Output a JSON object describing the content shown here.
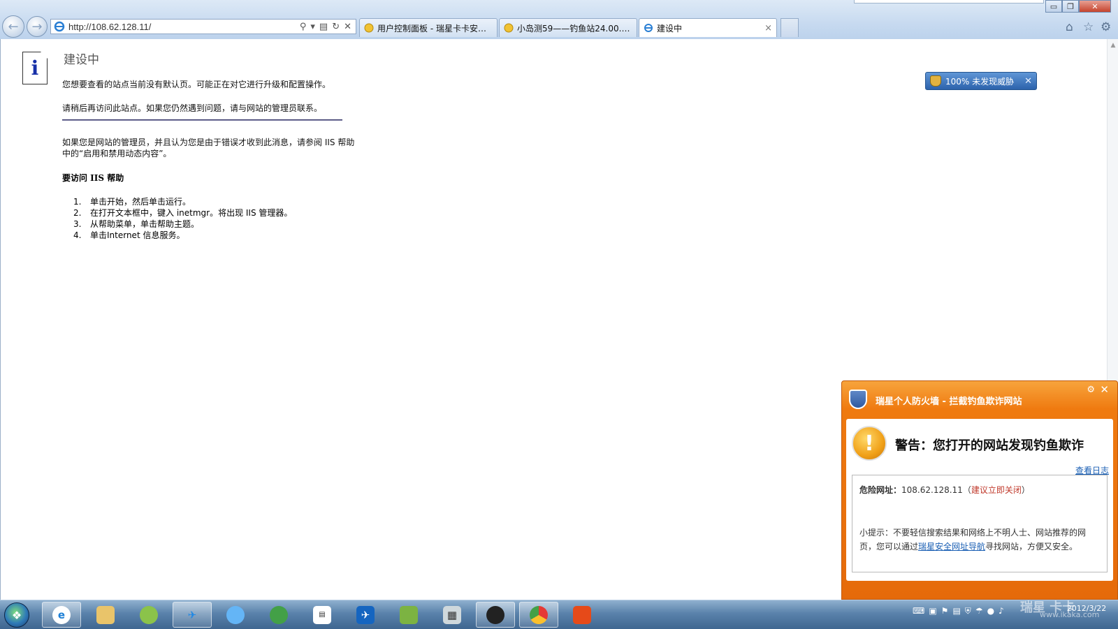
{
  "browser": {
    "url": "http://108.62.128.11/",
    "tabs": [
      {
        "label": "用户控制面板 - 瑞星卡卡安全...",
        "active": false
      },
      {
        "label": "小岛测59——钓鱼站24.00.03....",
        "active": false
      },
      {
        "label": "建设中",
        "active": true
      }
    ],
    "tab_close": "×",
    "window_controls": {
      "minimize": "▭",
      "restore": "❐",
      "close": "✕"
    }
  },
  "page": {
    "title": "建设中",
    "info_glyph": "i",
    "p1": "您想要查看的站点当前没有默认页。可能正在对它进行升级和配置操作。",
    "p2": "请稍后再访问此站点。如果您仍然遇到问题，请与网站的管理员联系。",
    "p3": "如果您是网站的管理员，并且认为您是由于错误才收到此消息，请参阅 IIS 帮助中的“启用和禁用动态内容”。",
    "help_heading": "要访问 IIS 帮助",
    "steps": [
      {
        "num": "1.",
        "text": "单击开始，然后单击运行。"
      },
      {
        "num": "2.",
        "text": "在打开文本框中，键入 inetmgr。将出现 IIS 管理器。"
      },
      {
        "num": "3.",
        "text": "从帮助菜单，单击帮助主题。"
      },
      {
        "num": "4.",
        "text": "单击Internet 信息服务。"
      }
    ]
  },
  "threat_badge": {
    "text": "100%  未发现威胁",
    "close": "✕"
  },
  "popup": {
    "title": "瑞星个人防火墙 - 拦截钓鱼欺诈网站",
    "gear": "⚙",
    "close": "✕",
    "warning_glyph": "!",
    "warning": "警告：您打开的网站发现钓鱼欺诈",
    "view_log": "查看日志",
    "danger_label": "危险网址：",
    "danger_url": "108.62.128.11",
    "danger_advice": "建议立即关闭",
    "tip_prefix": "小提示：不要轻信搜索结果和网络上不明人士、网站推荐的网页，您可以通过",
    "tip_link": "瑞星安全网址导航",
    "tip_suffix": "寻找网站，方便又安全。"
  },
  "taskbar": {
    "clock_time": "",
    "clock_date": "2012/3/22",
    "watermark": "瑞星 卡卡",
    "watermark_url": "www.ikaka.com"
  },
  "colors": {
    "popup_orange": "#ef7a10",
    "badge_blue": "#2d63ac",
    "link_blue": "#1a5fb4",
    "danger_red": "#c0392b"
  }
}
